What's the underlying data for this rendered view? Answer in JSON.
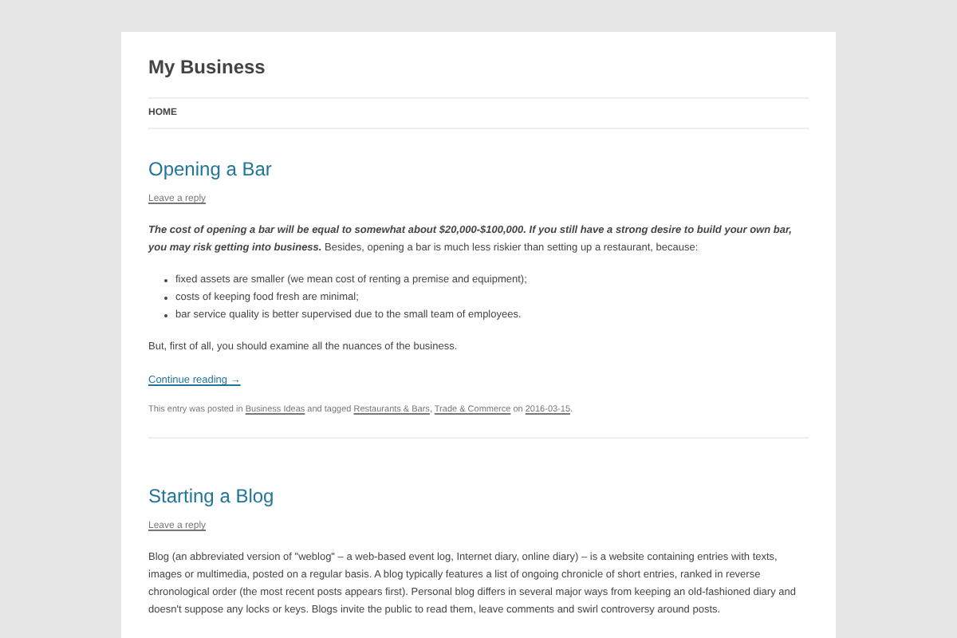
{
  "site": {
    "title": "My Business"
  },
  "nav": [
    {
      "label": "HOME",
      "selected": true
    }
  ],
  "posts": [
    {
      "title": "Opening a Bar",
      "reply": "Leave a reply",
      "paragraphs": [
        "**The cost of opening a bar will be equal to somewhat about $20,000-$100,000. If you still have a strong desire to build your own bar, you may risk getting into business.** Besides, opening a bar is much less riskier than setting up a restaurant, because:"
      ],
      "bullets": [
        "fixed assets are smaller (we mean cost of renting a premise and equipment);",
        "costs of keeping food fresh are minimal;",
        "bar service quality is better supervised due to the small team of employees."
      ],
      "after": [
        "But, first of all, you should examine all the nuances of the business."
      ],
      "continue": "Continue reading →",
      "meta": [
        {
          "kind": "text",
          "text": "This entry was posted in "
        },
        {
          "kind": "link",
          "text": "Business Ideas"
        },
        {
          "kind": "text",
          "text": " and tagged "
        },
        {
          "kind": "link",
          "text": "Restaurants & Bars"
        },
        {
          "kind": "text",
          "text": ", "
        },
        {
          "kind": "link",
          "text": "Trade & Commerce"
        },
        {
          "kind": "text",
          "text": " on "
        },
        {
          "kind": "link",
          "text": "2016-03-15"
        },
        {
          "kind": "text",
          "text": "."
        }
      ]
    },
    {
      "title": "Starting a Blog",
      "reply": "Leave a reply",
      "paragraphs": [
        "Blog (an abbreviated version of \"weblog\" – a web-based event log, Internet diary, online diary) – is a website containing entries with texts, images or multimedia, posted on a regular basis. A blog typically features a list of ongoing chronicle of short entries, ranked in reverse chronological order (the most recent posts appears first). Personal blog differs in several major ways from keeping an old-fashioned diary and doesn't suppose any locks or keys. Blogs invite the public to read them, leave comments and swirl controversy around posts."
      ]
    }
  ]
}
